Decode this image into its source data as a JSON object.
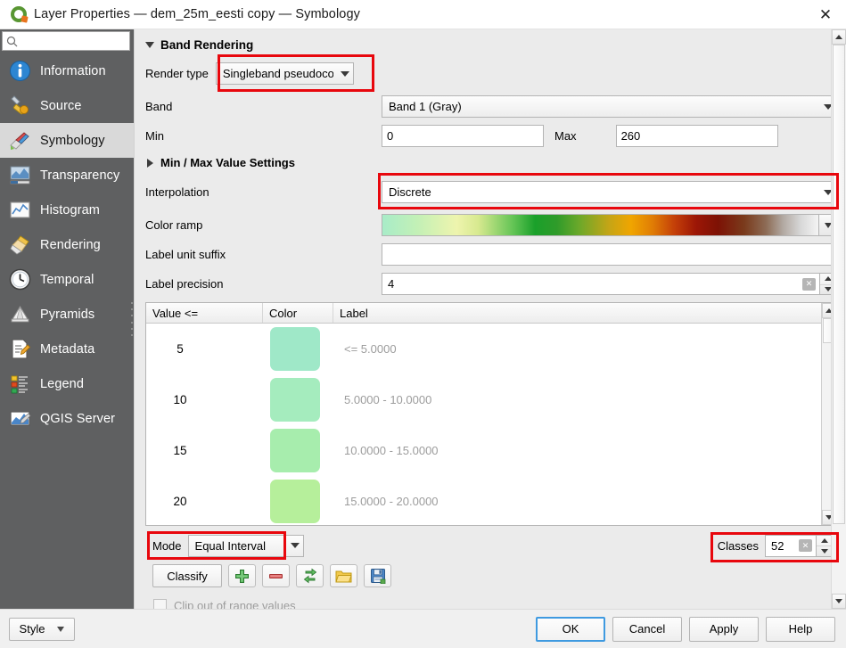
{
  "window": {
    "title": "Layer Properties — dem_25m_eesti copy — Symbology",
    "app_icon": "qgis-logo-icon",
    "close_label": "✕"
  },
  "sidebar": {
    "search": {
      "value": "",
      "placeholder": "",
      "icon": "search-icon"
    },
    "items": [
      {
        "label": "Information",
        "icon": "information-icon",
        "active": false
      },
      {
        "label": "Source",
        "icon": "source-wrench-icon",
        "active": false
      },
      {
        "label": "Symbology",
        "icon": "symbology-brush-icon",
        "active": true
      },
      {
        "label": "Transparency",
        "icon": "transparency-icon",
        "active": false
      },
      {
        "label": "Histogram",
        "icon": "histogram-icon",
        "active": false
      },
      {
        "label": "Rendering",
        "icon": "rendering-brush-icon",
        "active": false
      },
      {
        "label": "Temporal",
        "icon": "clock-icon",
        "active": false
      },
      {
        "label": "Pyramids",
        "icon": "pyramids-icon",
        "active": false
      },
      {
        "label": "Metadata",
        "icon": "metadata-pencil-icon",
        "active": false
      },
      {
        "label": "Legend",
        "icon": "legend-icon",
        "active": false
      },
      {
        "label": "QGIS Server",
        "icon": "qgis-server-icon",
        "active": false
      }
    ]
  },
  "band_rendering": {
    "group_title": "Band Rendering",
    "render_type": {
      "label": "Render type",
      "value": "Singleband pseudocolor",
      "highlighted": true
    },
    "band": {
      "label": "Band",
      "value": "Band 1 (Gray)"
    },
    "min": {
      "label": "Min",
      "value": "0"
    },
    "max": {
      "label": "Max",
      "value": "260"
    },
    "min_max_settings": {
      "label": "Min / Max Value Settings",
      "expanded": false
    },
    "interpolation": {
      "label": "Interpolation",
      "value": "Discrete",
      "highlighted": true
    },
    "color_ramp": {
      "label": "Color ramp",
      "value": "elevation-color-ramp"
    },
    "label_unit_suffix": {
      "label": "Label unit suffix",
      "value": ""
    },
    "label_precision": {
      "label": "Label precision",
      "value": "4"
    }
  },
  "classes_table": {
    "headers": [
      "Value <=",
      "Color",
      "Label"
    ],
    "rows": [
      {
        "value": "5",
        "color": "#9fe8c8",
        "label": "<= 5.0000"
      },
      {
        "value": "10",
        "color": "#a5ecbe",
        "label": "5.0000 - 10.0000"
      },
      {
        "value": "15",
        "color": "#a7edad",
        "label": "10.0000 - 15.0000"
      },
      {
        "value": "20",
        "color": "#b6ef9b",
        "label": "15.0000 - 20.0000"
      }
    ]
  },
  "bottom_controls": {
    "mode": {
      "label": "Mode",
      "value": "Equal Interval",
      "highlighted": true
    },
    "classes": {
      "label": "Classes",
      "value": "52",
      "highlighted": true
    },
    "classify_button": "Classify",
    "add_button_icon": "add-plus-icon",
    "remove_button_icon": "remove-minus-icon",
    "sort_button_icon": "sort-arrows-icon",
    "load_button_icon": "open-folder-icon",
    "save_button_icon": "save-disk-icon",
    "clip_checkbox": {
      "label": "Clip out of range values",
      "checked": false
    }
  },
  "footer": {
    "style_button": "Style",
    "ok_button": "OK",
    "cancel_button": "Cancel",
    "apply_button": "Apply",
    "help_button": "Help"
  },
  "colors": {
    "highlight": "#e8070d",
    "sidebar_bg": "#5f6061",
    "sidebar_active_bg": "#d9d9d9",
    "panel_bg": "#ebebeb",
    "focus_blue": "#3f9ae0"
  }
}
